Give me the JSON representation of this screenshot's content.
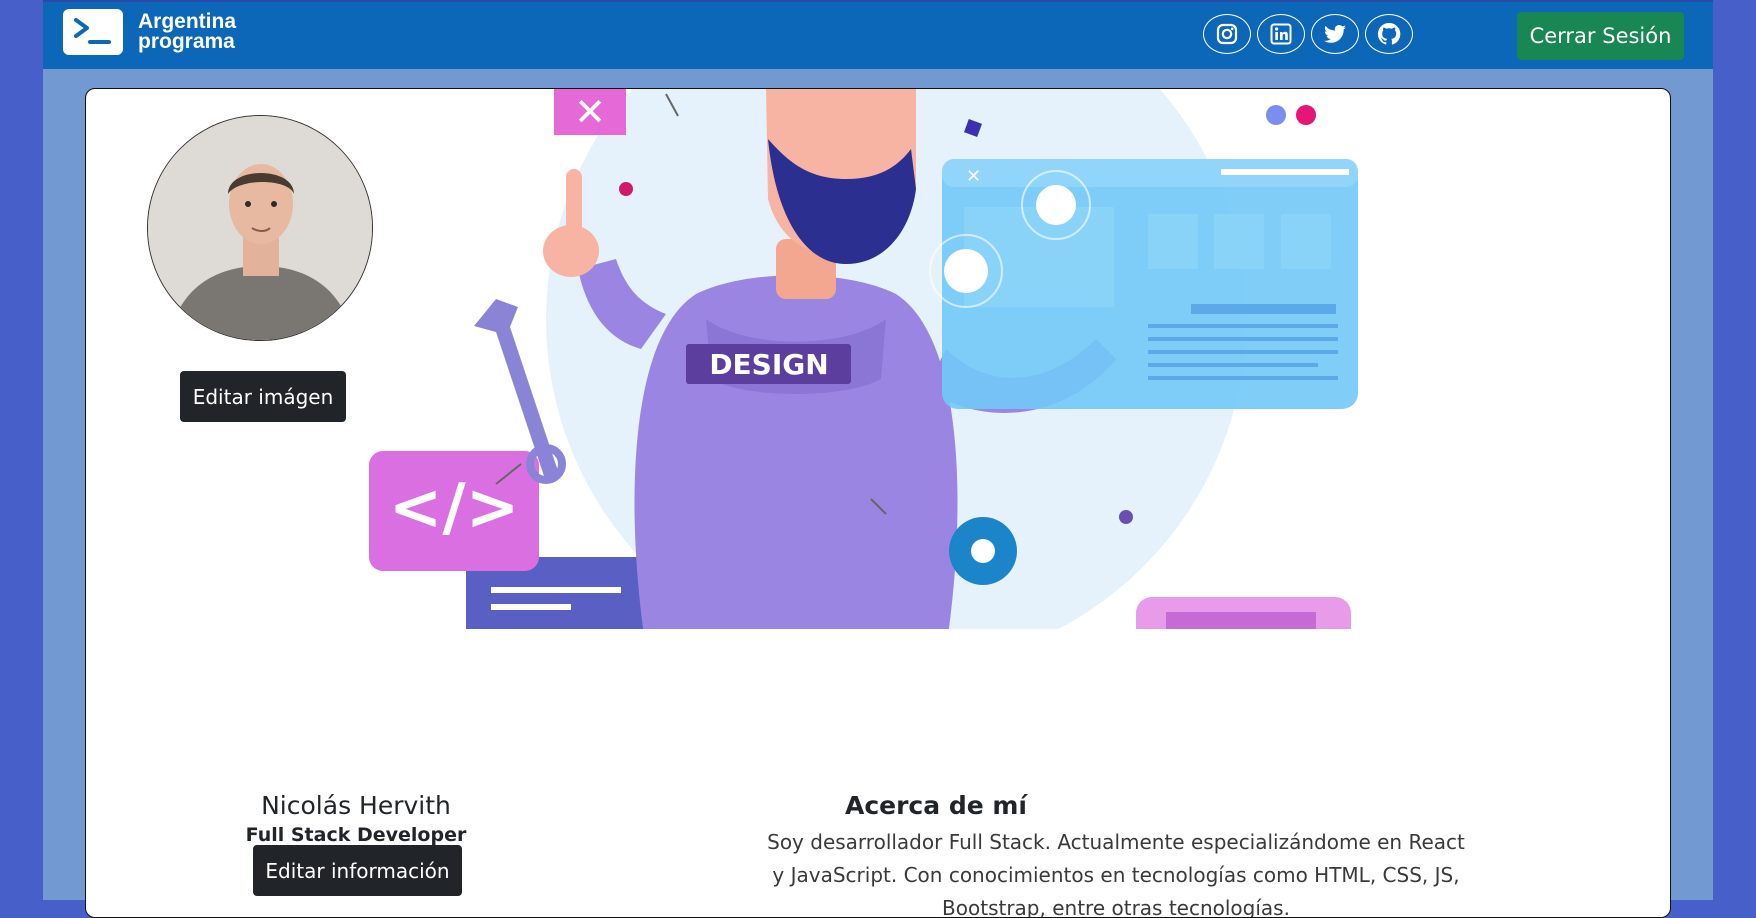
{
  "brand": {
    "line1": "Argentina",
    "line2": "programa"
  },
  "header": {
    "social": [
      {
        "icon": "instagram-icon"
      },
      {
        "icon": "linkedin-icon"
      },
      {
        "icon": "twitter-icon"
      },
      {
        "icon": "github-icon"
      }
    ],
    "logout_label": "Cerrar Sesión"
  },
  "banner": {
    "shirt_text": "DESIGN"
  },
  "profile": {
    "edit_image_label": "Editar imágen",
    "name": "Nicolás Hervith",
    "role": "Full Stack Developer",
    "edit_info_label": "Editar información"
  },
  "about": {
    "title": "Acerca de mí",
    "text": "Soy desarrollador Full Stack. Actualmente especializándome en React y JavaScript. Con conocimientos en tecnologías como HTML, CSS, JS, Bootstrap, entre otras tecnologías."
  },
  "colors": {
    "page_bg": "#4760c9",
    "shell_bg": "#7399d3",
    "navbar_bg": "#0d67b8",
    "logout_bg": "#198754",
    "dark_button_bg": "#212529"
  }
}
